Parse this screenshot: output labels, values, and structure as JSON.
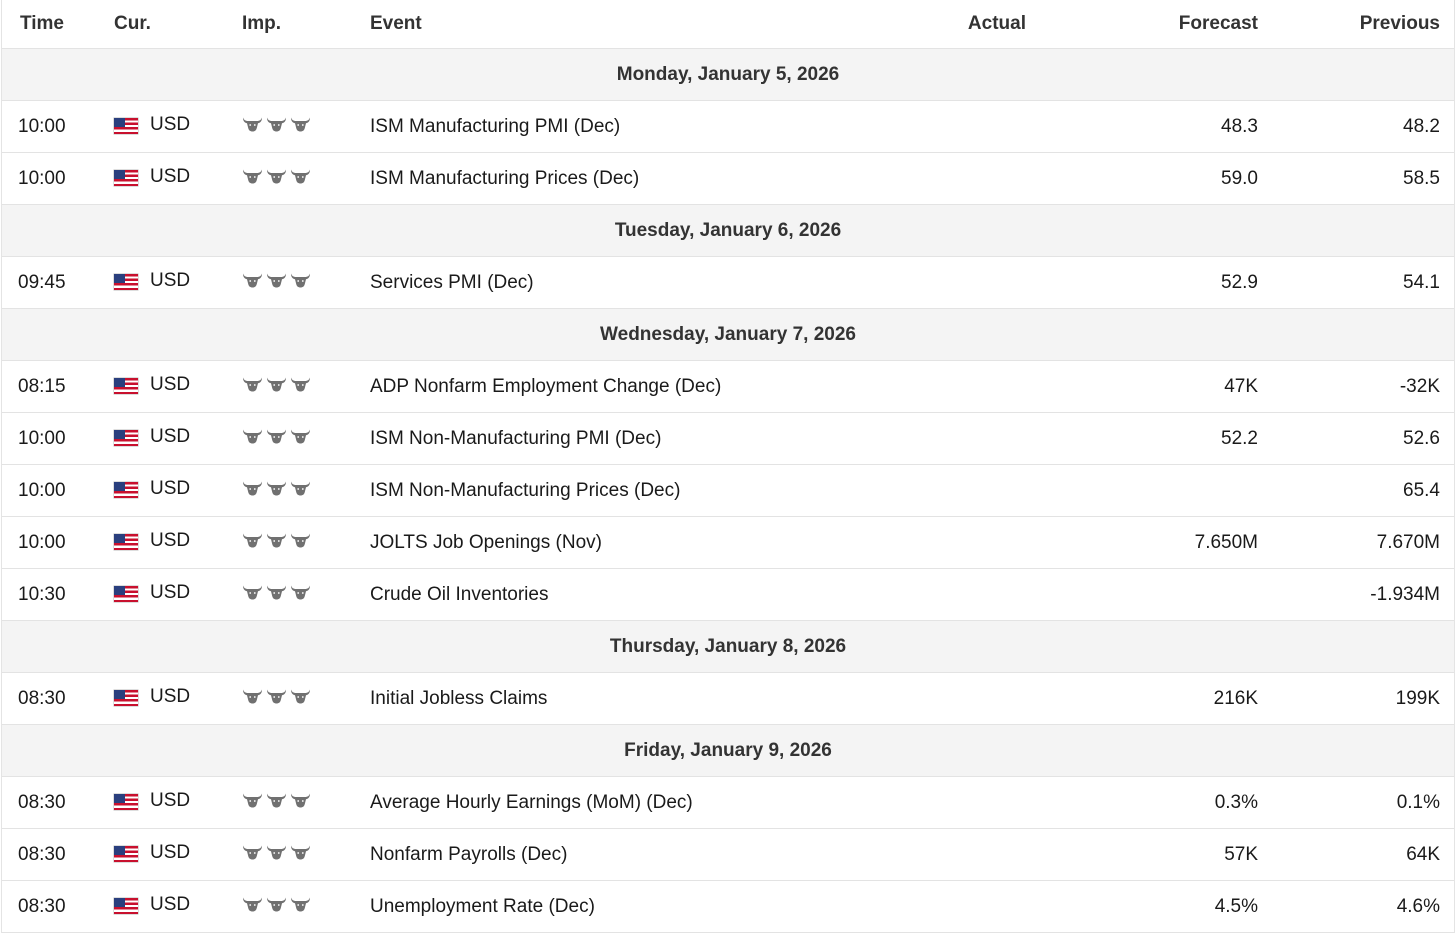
{
  "table": {
    "headers": {
      "time": "Time",
      "currency": "Cur.",
      "importance": "Imp.",
      "event": "Event",
      "actual": "Actual",
      "forecast": "Forecast",
      "previous": "Previous"
    },
    "importance_icon": "bull-icon",
    "flag_icon": "us-flag-icon",
    "accent_colors": {
      "flag_red": "#c8102e",
      "flag_blue": "#2a3f7e",
      "bull": "#707070",
      "date_row_bg": "#f4f4f4"
    },
    "days": [
      {
        "date": "Monday, January 5, 2026",
        "events": [
          {
            "time": "10:00",
            "currency": "USD",
            "importance": 3,
            "event": "ISM Manufacturing PMI (Dec)",
            "actual": "",
            "forecast": "48.3",
            "previous": "48.2"
          },
          {
            "time": "10:00",
            "currency": "USD",
            "importance": 3,
            "event": "ISM Manufacturing Prices (Dec)",
            "actual": "",
            "forecast": "59.0",
            "previous": "58.5"
          }
        ]
      },
      {
        "date": "Tuesday, January 6, 2026",
        "events": [
          {
            "time": "09:45",
            "currency": "USD",
            "importance": 3,
            "event": "Services PMI (Dec)",
            "actual": "",
            "forecast": "52.9",
            "previous": "54.1"
          }
        ]
      },
      {
        "date": "Wednesday, January 7, 2026",
        "events": [
          {
            "time": "08:15",
            "currency": "USD",
            "importance": 3,
            "event": "ADP Nonfarm Employment Change (Dec)",
            "actual": "",
            "forecast": "47K",
            "previous": "-32K"
          },
          {
            "time": "10:00",
            "currency": "USD",
            "importance": 3,
            "event": "ISM Non-Manufacturing PMI (Dec)",
            "actual": "",
            "forecast": "52.2",
            "previous": "52.6"
          },
          {
            "time": "10:00",
            "currency": "USD",
            "importance": 3,
            "event": "ISM Non-Manufacturing Prices (Dec)",
            "actual": "",
            "forecast": "",
            "previous": "65.4"
          },
          {
            "time": "10:00",
            "currency": "USD",
            "importance": 3,
            "event": "JOLTS Job Openings (Nov)",
            "actual": "",
            "forecast": "7.650M",
            "previous": "7.670M"
          },
          {
            "time": "10:30",
            "currency": "USD",
            "importance": 3,
            "event": "Crude Oil Inventories",
            "actual": "",
            "forecast": "",
            "previous": "-1.934M"
          }
        ]
      },
      {
        "date": "Thursday, January 8, 2026",
        "events": [
          {
            "time": "08:30",
            "currency": "USD",
            "importance": 3,
            "event": "Initial Jobless Claims",
            "actual": "",
            "forecast": "216K",
            "previous": "199K"
          }
        ]
      },
      {
        "date": "Friday, January 9, 2026",
        "events": [
          {
            "time": "08:30",
            "currency": "USD",
            "importance": 3,
            "event": "Average Hourly Earnings (MoM) (Dec)",
            "actual": "",
            "forecast": "0.3%",
            "previous": "0.1%"
          },
          {
            "time": "08:30",
            "currency": "USD",
            "importance": 3,
            "event": "Nonfarm Payrolls (Dec)",
            "actual": "",
            "forecast": "57K",
            "previous": "64K"
          },
          {
            "time": "08:30",
            "currency": "USD",
            "importance": 3,
            "event": "Unemployment Rate (Dec)",
            "actual": "",
            "forecast": "4.5%",
            "previous": "4.6%"
          }
        ]
      }
    ]
  }
}
